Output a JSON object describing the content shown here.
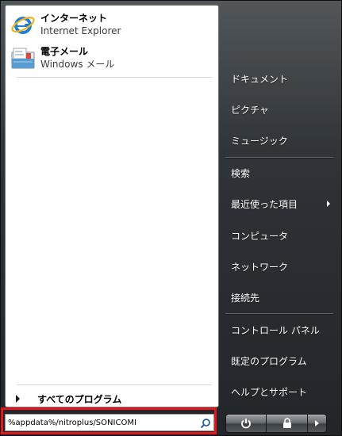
{
  "pinned": [
    {
      "title": "インターネット",
      "subtitle": "Internet Explorer",
      "icon": "internet-explorer-icon"
    },
    {
      "title": "電子メール",
      "subtitle": "Windows メール",
      "icon": "windows-mail-icon"
    }
  ],
  "all_programs": {
    "label": "すべてのプログラム"
  },
  "search": {
    "value": "%appdata%/nitroplus/SONICOMI",
    "icon": "search-icon",
    "highlight_color": "#e3161c"
  },
  "right_menu": {
    "documents": "ドキュメント",
    "pictures": "ピクチャ",
    "music": "ミュージック",
    "search": "検索",
    "recent_items": "最近使った項目",
    "computer": "コンピュータ",
    "network": "ネットワーク",
    "connect_to": "接続先",
    "control_panel": "コントロール パネル",
    "default_programs": "既定のプログラム",
    "help_support": "ヘルプとサポート"
  },
  "power_buttons": {
    "power_icon": "power-icon",
    "lock_icon": "lock-icon",
    "more_icon": "arrow-right-icon"
  }
}
